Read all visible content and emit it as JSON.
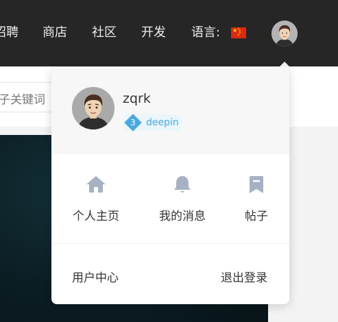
{
  "nav": {
    "items": [
      "招聘",
      "商店",
      "社区",
      "开发"
    ],
    "language_label": "语言:",
    "flag_icon": "china-flag-icon"
  },
  "search": {
    "value": "子关键词"
  },
  "dropdown": {
    "username": "zqrk",
    "level": {
      "number": "3",
      "name": "deepin"
    },
    "quick_actions": [
      {
        "label": "个人主页",
        "icon": "home-icon"
      },
      {
        "label": "我的消息",
        "icon": "bell-icon"
      },
      {
        "label": "帖子",
        "icon": "bookmark-icon"
      }
    ],
    "footer": {
      "user_center": "用户中心",
      "logout": "退出登录"
    }
  },
  "colors": {
    "topbar": "#262626",
    "accent": "#4aa9e0",
    "icon_gray": "#a6b2c3"
  }
}
